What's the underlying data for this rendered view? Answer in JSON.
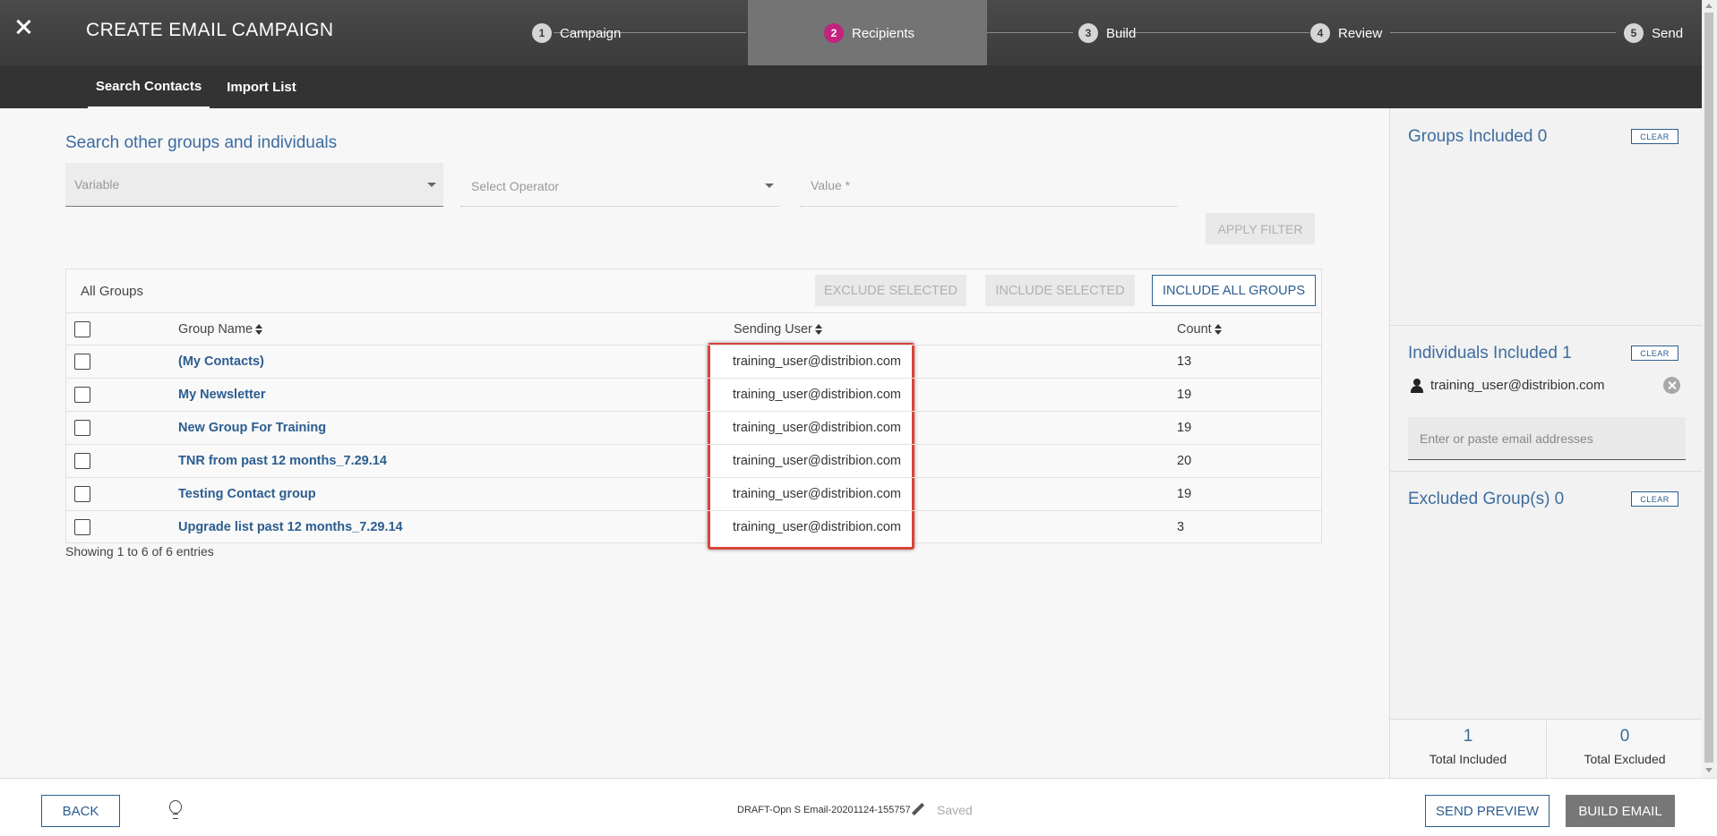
{
  "header": {
    "title": "CREATE EMAIL CAMPAIGN",
    "steps": [
      {
        "num": "1",
        "label": "Campaign"
      },
      {
        "num": "2",
        "label": "Recipients"
      },
      {
        "num": "3",
        "label": "Build"
      },
      {
        "num": "4",
        "label": "Review"
      },
      {
        "num": "5",
        "label": "Send"
      }
    ],
    "active_step": "Recipients",
    "accent_color": "#c2237f"
  },
  "subnav": {
    "tabs": [
      "Search Contacts",
      "Import List"
    ],
    "active_tab": "Search Contacts"
  },
  "search": {
    "title": "Search other groups and individuals",
    "variable_placeholder": "Variable",
    "operator_placeholder": "Select Operator",
    "value_placeholder": "Value *",
    "apply_label": "APPLY FILTER"
  },
  "groups": {
    "title": "All Groups",
    "exclude_label": "EXCLUDE SELECTED",
    "include_label": "INCLUDE SELECTED",
    "include_all_label": "INCLUDE ALL GROUPS",
    "columns": [
      "Group Name",
      "Sending User",
      "Count"
    ],
    "rows": [
      {
        "name": "(My Contacts)",
        "user": "training_user@distribion.com",
        "count": "13"
      },
      {
        "name": "My Newsletter",
        "user": "training_user@distribion.com",
        "count": "19"
      },
      {
        "name": "New Group For Training",
        "user": "training_user@distribion.com",
        "count": "19"
      },
      {
        "name": "TNR from past 12 months_7.29.14",
        "user": "training_user@distribion.com",
        "count": "20"
      },
      {
        "name": "Testing Contact group",
        "user": "training_user@distribion.com",
        "count": "19"
      },
      {
        "name": "Upgrade list past 12 months_7.29.14",
        "user": "training_user@distribion.com",
        "count": "3"
      }
    ],
    "showing": "Showing 1 to 6 of 6 entries"
  },
  "sidebar": {
    "groups_included": "Groups Included 0",
    "individuals_included": "Individuals Included 1",
    "excluded_groups": "Excluded Group(s) 0",
    "clear_label": "CLEAR",
    "individual_email": "training_user@distribion.com",
    "email_placeholder": "Enter or paste email addresses",
    "total_included": "1",
    "total_included_label": "Total Included",
    "total_excluded": "0",
    "total_excluded_label": "Total Excluded"
  },
  "footer": {
    "back_label": "BACK",
    "draft_name": "DRAFT-Opn S Email-20201124-155757",
    "saved_label": "Saved",
    "send_preview_label": "SEND PREVIEW",
    "build_label": "BUILD EMAIL"
  },
  "icons": [
    "close-icon",
    "chevron-down-icon",
    "sort-icon",
    "person-icon",
    "remove-icon",
    "lightbulb-icon",
    "pencil-icon"
  ]
}
